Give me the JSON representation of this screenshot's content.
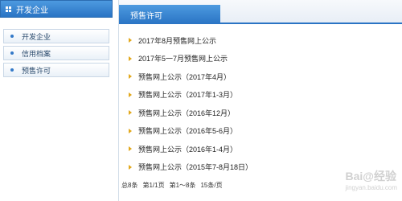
{
  "sidebar": {
    "title": "开发企业",
    "items": [
      {
        "label": "开发企业"
      },
      {
        "label": "信用档案"
      },
      {
        "label": "预售许可"
      }
    ]
  },
  "main": {
    "tab_title": "预售许可",
    "list": [
      {
        "title": "2017年8月预售网上公示"
      },
      {
        "title": "2017年5一7月预售网上公示"
      },
      {
        "title": "预售网上公示（2017年4月）"
      },
      {
        "title": "预售网上公示（2017年1-3月）"
      },
      {
        "title": "预售网上公示（2016年12月）"
      },
      {
        "title": "预售网上公示（2016年5-6月）"
      },
      {
        "title": "预售网上公示（2016年1-4月）"
      },
      {
        "title": "预售网上公示（2015年7-8月18日）"
      }
    ],
    "pager": {
      "total": "总8条",
      "page": "第1/1页",
      "range": "第1～8条",
      "per_page": "15条/页"
    }
  },
  "watermark": {
    "text": "Bai@经验",
    "sub": "jingyan.baidu.com"
  }
}
